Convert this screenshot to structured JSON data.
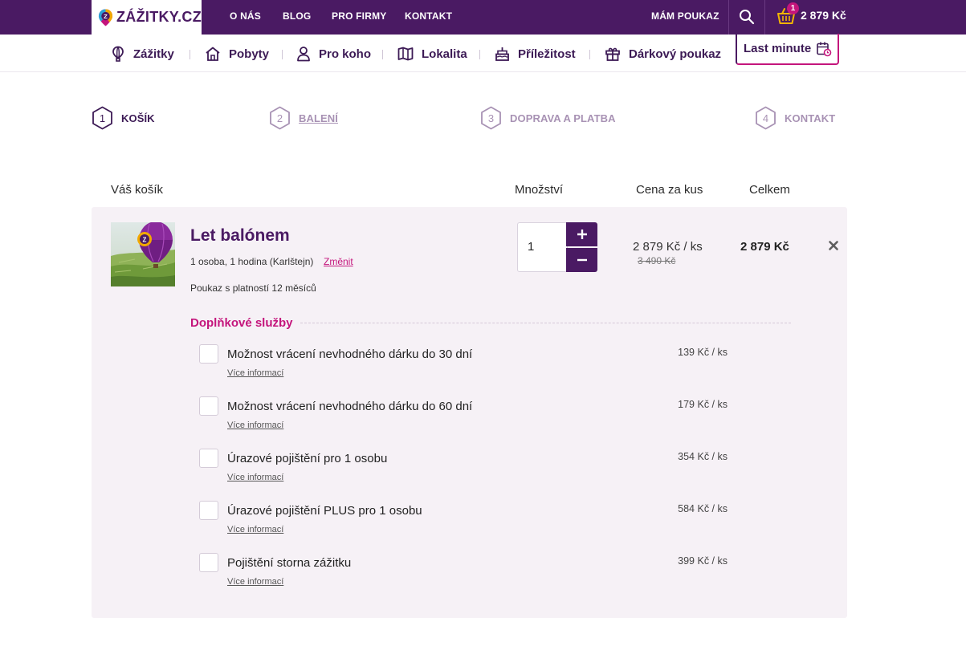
{
  "brand": {
    "name": "ZÁŽITKY.CZ"
  },
  "topnav": {
    "links": [
      "O NÁS",
      "BLOG",
      "PRO FIRMY",
      "KONTAKT"
    ],
    "voucher": "MÁM POUKAZ",
    "basket_count": "1",
    "basket_total": "2 879 Kč"
  },
  "categories": [
    {
      "label": "Zážitky",
      "icon": "balloon-icon"
    },
    {
      "label": "Pobyty",
      "icon": "house-icon"
    },
    {
      "label": "Pro koho",
      "icon": "person-icon"
    },
    {
      "label": "Lokalita",
      "icon": "map-icon"
    },
    {
      "label": "Příležitost",
      "icon": "cake-icon"
    },
    {
      "label": "Dárkový poukaz",
      "icon": "gift-icon"
    }
  ],
  "last_minute": "Last minute",
  "steps": [
    {
      "num": "1",
      "label": "KOŠÍK"
    },
    {
      "num": "2",
      "label": "BALENÍ"
    },
    {
      "num": "3",
      "label": "DOPRAVA A PLATBA"
    },
    {
      "num": "4",
      "label": "KONTAKT"
    }
  ],
  "table": {
    "col_cart": "Váš košík",
    "col_qty": "Množství",
    "col_unit": "Cena za kus",
    "col_total": "Celkem"
  },
  "product": {
    "title": "Let balónem",
    "variant": "1 osoba, 1 hodina (Karlštejn)",
    "change": "Změnit",
    "validity": "Poukaz s platností 12 měsíců",
    "quantity": "1",
    "unit_price": "2 879 Kč / ks",
    "old_price": "3 490 Kč",
    "total": "2 879 Kč"
  },
  "addons": {
    "title": "Doplňkové služby",
    "more_label": "Více informací",
    "items": [
      {
        "name": "Možnost vrácení nevhodného dárku do 30 dní",
        "price": "139 Kč / ks"
      },
      {
        "name": "Možnost vrácení nevhodného dárku do 60 dní",
        "price": "179 Kč / ks"
      },
      {
        "name": "Úrazové pojištění pro 1 osobu",
        "price": "354 Kč / ks"
      },
      {
        "name": "Úrazové pojištění PLUS pro 1 osobu",
        "price": "584 Kč / ks"
      },
      {
        "name": "Pojištění storna zážitku",
        "price": "399 Kč / ks"
      }
    ]
  },
  "colors": {
    "brand": "#4a1a63",
    "accent": "#c4157c",
    "panel": "#f6f1f6"
  }
}
